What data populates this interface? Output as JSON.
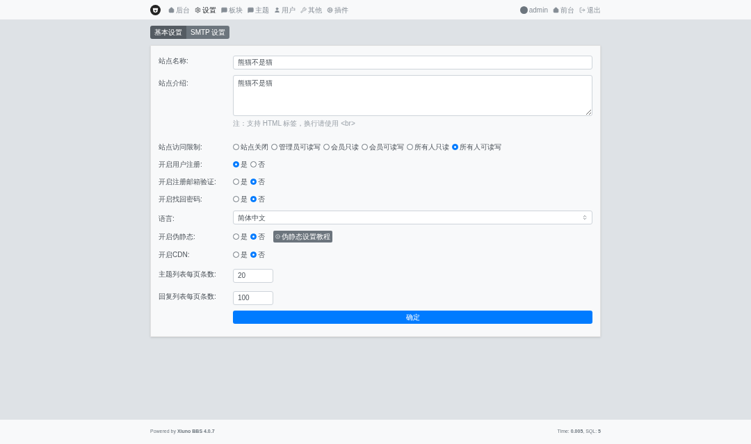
{
  "nav": {
    "items": [
      {
        "label": "后台",
        "selected": false
      },
      {
        "label": "设置",
        "selected": true
      },
      {
        "label": "板块",
        "selected": false
      },
      {
        "label": "主题",
        "selected": false
      },
      {
        "label": "用户",
        "selected": false
      },
      {
        "label": "其他",
        "selected": false
      },
      {
        "label": "插件",
        "selected": false
      }
    ],
    "right": [
      {
        "label": "admin"
      },
      {
        "label": "前台"
      },
      {
        "label": "退出"
      }
    ]
  },
  "tabs": [
    {
      "label": "基本设置",
      "selected": true
    },
    {
      "label": "SMTP 设置",
      "selected": false
    }
  ],
  "form": {
    "fields": [
      {
        "kind": "text",
        "label": "站点名称:",
        "value": "熊猫不是猫"
      },
      {
        "kind": "textarea",
        "label": "站点介绍:",
        "value": "熊猫不是猫",
        "hint": "注：支持 HTML 标签，换行请使用 <br>"
      },
      {
        "kind": "radio",
        "label": "站点访问限制:",
        "options": [
          {
            "label": "站点关闭",
            "selected": false
          },
          {
            "label": "管理员可读写",
            "selected": false
          },
          {
            "label": "会员只读",
            "selected": false
          },
          {
            "label": "会员可读写",
            "selected": false
          },
          {
            "label": "所有人只读",
            "selected": false
          },
          {
            "label": "所有人可读写",
            "selected": true
          }
        ]
      },
      {
        "kind": "radio",
        "label": "开启用户注册:",
        "options": [
          {
            "label": "是",
            "selected": true
          },
          {
            "label": "否",
            "selected": false
          }
        ]
      },
      {
        "kind": "radio",
        "label": "开启注册邮箱验证:",
        "options": [
          {
            "label": "是",
            "selected": false
          },
          {
            "label": "否",
            "selected": true
          }
        ]
      },
      {
        "kind": "radio",
        "label": "开启找回密码:",
        "options": [
          {
            "label": "是",
            "selected": false
          },
          {
            "label": "否",
            "selected": true
          }
        ]
      },
      {
        "kind": "select",
        "label": "语言:",
        "value": "简体中文"
      },
      {
        "kind": "radio",
        "label": "开启伪静态:",
        "options": [
          {
            "label": "是",
            "selected": false
          },
          {
            "label": "否",
            "selected": true
          }
        ],
        "badge": "伪静态设置教程"
      },
      {
        "kind": "radio",
        "label": "开启CDN:",
        "options": [
          {
            "label": "是",
            "selected": false
          },
          {
            "label": "否",
            "selected": true
          }
        ]
      },
      {
        "kind": "short",
        "label": "主题列表每页条数:",
        "value": "20"
      },
      {
        "kind": "short",
        "label": "回复列表每页条数:",
        "value": "100"
      }
    ],
    "submit": "确定"
  },
  "footer": {
    "left": "Powered by **Xiuno BBS 4.0.7**",
    "right": "Time: **0.005**, SQL: **5**"
  }
}
